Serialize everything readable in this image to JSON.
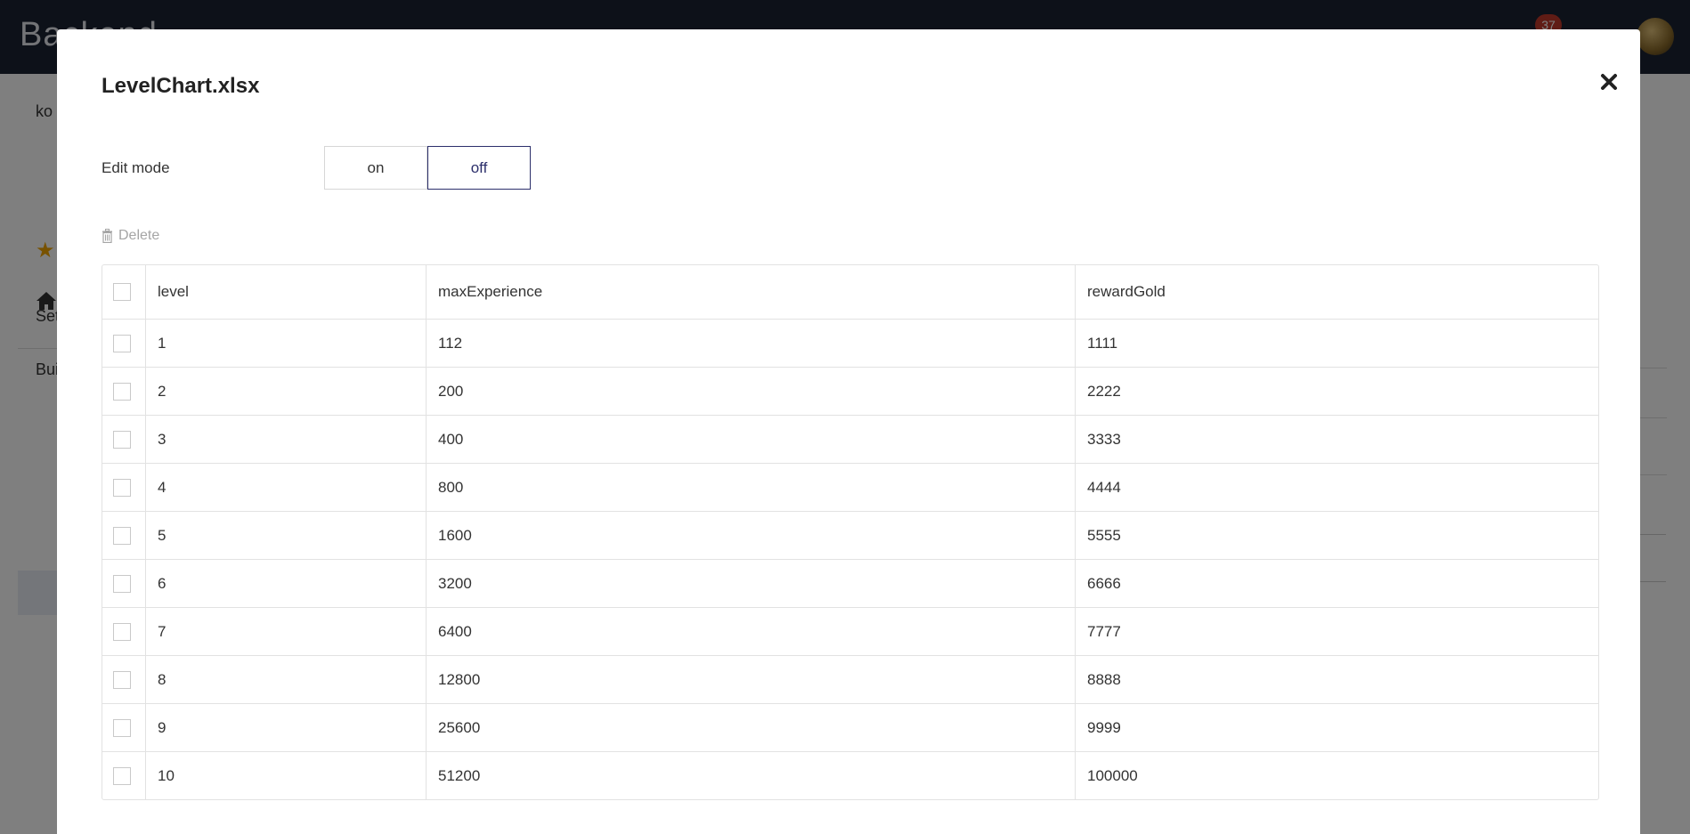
{
  "background": {
    "brand": "Backend",
    "notification_count": "37",
    "sidebar_fragments": [
      "ko",
      "Set",
      "Bui"
    ]
  },
  "modal": {
    "title": "LevelChart.xlsx",
    "close_icon": "close-icon",
    "edit_mode": {
      "label": "Edit mode",
      "options": [
        "on",
        "off"
      ],
      "selected": "off"
    },
    "delete_label": "Delete",
    "table": {
      "columns": [
        "level",
        "maxExperience",
        "rewardGold"
      ],
      "rows": [
        [
          "1",
          "112",
          "1111"
        ],
        [
          "2",
          "200",
          "2222"
        ],
        [
          "3",
          "400",
          "3333"
        ],
        [
          "4",
          "800",
          "4444"
        ],
        [
          "5",
          "1600",
          "5555"
        ],
        [
          "6",
          "3200",
          "6666"
        ],
        [
          "7",
          "6400",
          "7777"
        ],
        [
          "8",
          "12800",
          "8888"
        ],
        [
          "9",
          "25600",
          "9999"
        ],
        [
          "10",
          "51200",
          "100000"
        ]
      ]
    }
  },
  "colors": {
    "topbar": "#1b2232",
    "accent": "#2c2f6b",
    "badge": "#c0392b"
  }
}
